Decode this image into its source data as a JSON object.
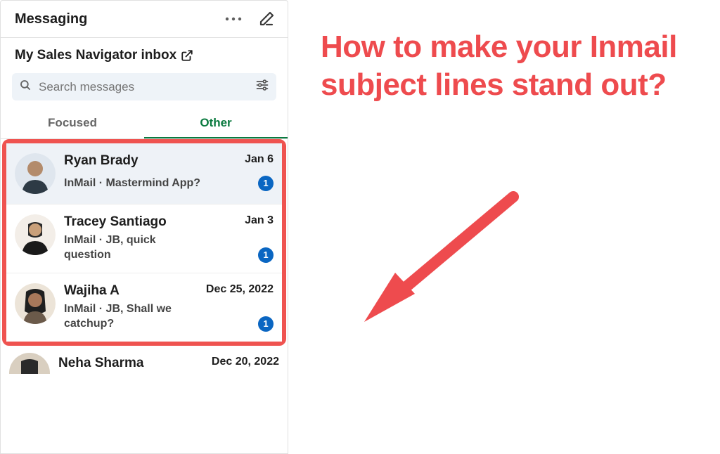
{
  "header": {
    "title": "Messaging"
  },
  "subheader": {
    "title": "My Sales Navigator inbox"
  },
  "search": {
    "placeholder": "Search messages"
  },
  "tabs": {
    "focused": "Focused",
    "other": "Other",
    "active": "other"
  },
  "messages": [
    {
      "name": "Ryan Brady",
      "date": "Jan 6",
      "preview": "InMail · Mastermind App?",
      "unread": "1"
    },
    {
      "name": "Tracey Santiago",
      "date": "Jan 3",
      "preview": "InMail · JB, quick question",
      "unread": "1"
    },
    {
      "name": "Wajiha A",
      "date": "Dec 25, 2022",
      "preview": "InMail · JB, Shall we catchup?",
      "unread": "1"
    }
  ],
  "partial": {
    "name": "Neha Sharma",
    "date": "Dec 20, 2022"
  },
  "annotation": {
    "headline": "How to make your Inmail subject lines stand out?"
  },
  "colors": {
    "accent": "#ee4b4e",
    "brand": "#0a66c2",
    "tabActive": "#0a7a3f",
    "highlight": "#ef5350"
  }
}
